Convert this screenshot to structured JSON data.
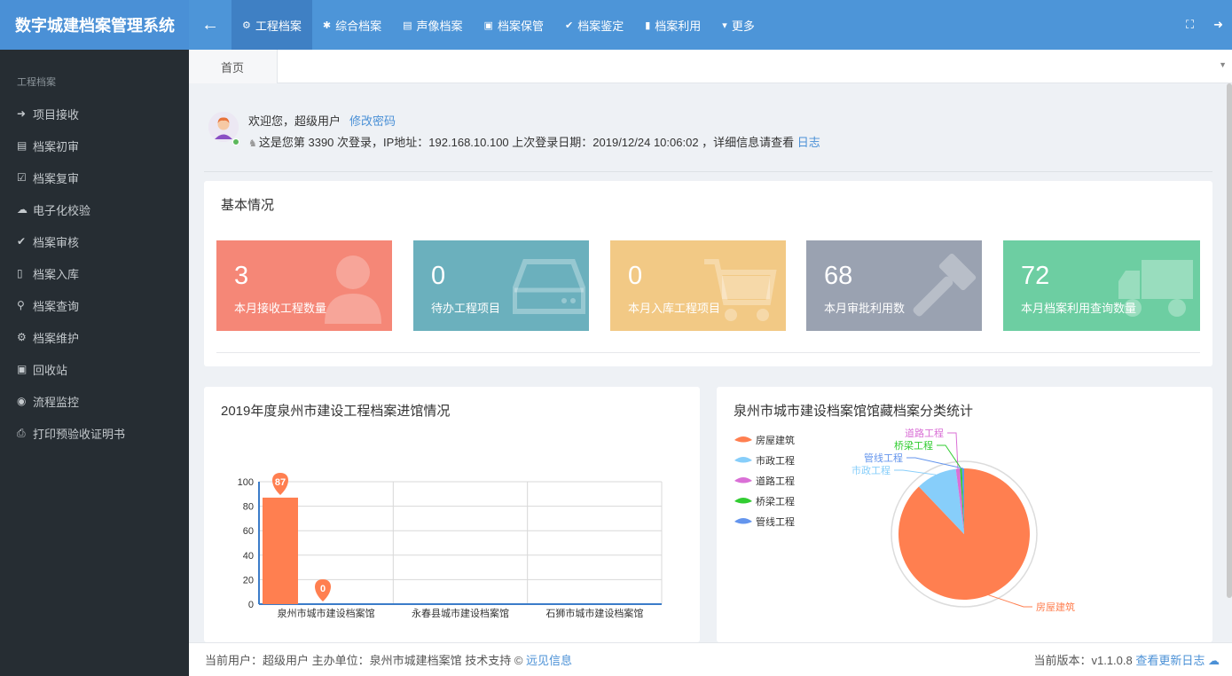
{
  "app": {
    "title": "数字城建档案管理系统",
    "back_icon": "arrow-left-icon"
  },
  "topnav": [
    {
      "label": "工程档案",
      "icon": "gear-icon",
      "active": true
    },
    {
      "label": "综合档案",
      "icon": "asterisk-icon",
      "active": false
    },
    {
      "label": "声像档案",
      "icon": "film-icon",
      "active": false
    },
    {
      "label": "档案保管",
      "icon": "archive-icon",
      "active": false
    },
    {
      "label": "档案鉴定",
      "icon": "check-circle-icon",
      "active": false
    },
    {
      "label": "档案利用",
      "icon": "bookmark-icon",
      "active": false
    },
    {
      "label": "更多",
      "icon": "caret-down-icon",
      "active": false
    }
  ],
  "sidebar": {
    "section": "工程档案",
    "items": [
      {
        "label": "项目接收",
        "icon": "arrow-right-icon"
      },
      {
        "label": "档案初审",
        "icon": "calendar-plus-icon"
      },
      {
        "label": "档案复审",
        "icon": "calendar-check-icon"
      },
      {
        "label": "电子化校验",
        "icon": "cloud-icon"
      },
      {
        "label": "档案审核",
        "icon": "check-icon"
      },
      {
        "label": "档案入库",
        "icon": "book-icon"
      },
      {
        "label": "档案查询",
        "icon": "search-icon"
      },
      {
        "label": "档案维护",
        "icon": "gear-icon"
      },
      {
        "label": "回收站",
        "icon": "trash-icon"
      },
      {
        "label": "流程监控",
        "icon": "dot-circle-icon"
      },
      {
        "label": "打印预验收证明书",
        "icon": "print-icon"
      }
    ]
  },
  "tabs": {
    "home": "首页"
  },
  "welcome": {
    "greeting": "欢迎您，超级用户",
    "change_password": "修改密码",
    "login_info": "这是您第 3390 次登录，IP地址：192.168.10.100 上次登录日期：2019/12/24 10:06:02 ，详细信息请查看",
    "log_link": "日志"
  },
  "basic": {
    "title": "基本情况",
    "stats": [
      {
        "value": "3",
        "label": "本月接收工程数量",
        "color": "#f58777",
        "icon": "user-icon"
      },
      {
        "value": "0",
        "label": "待办工程项目",
        "color": "#6bb0bd",
        "icon": "hdd-icon"
      },
      {
        "value": "0",
        "label": "本月入库工程项目",
        "color": "#f2c985",
        "icon": "cart-icon"
      },
      {
        "value": "68",
        "label": "本月审批利用数",
        "color": "#9aa2b1",
        "icon": "gavel-icon"
      },
      {
        "value": "72",
        "label": "本月档案利用查询数量",
        "color": "#6dcea2",
        "icon": "truck-icon"
      }
    ]
  },
  "chart_data": [
    {
      "type": "bar",
      "title": "2019年度泉州市建设工程档案进馆情况",
      "categories": [
        "泉州市城市建设档案馆",
        "永春县城市建设档案馆",
        "石狮市城市建设档案馆"
      ],
      "series": [
        {
          "values": [
            87,
            null,
            null
          ],
          "color": "#ff7f50"
        },
        {
          "values": [
            0,
            null,
            null
          ],
          "color": "#ff7f50"
        }
      ],
      "ylim": [
        0,
        100
      ],
      "yticks": [
        "0",
        "20",
        "40",
        "60",
        "80",
        "100"
      ],
      "data_labels": [
        "87",
        "0"
      ],
      "grid": true
    },
    {
      "type": "pie",
      "title": "泉州市城市建设档案馆馆藏档案分类统计",
      "slices": [
        {
          "name": "房屋建筑",
          "value": 87,
          "color": "#ff7f50"
        },
        {
          "name": "市政工程",
          "value": 10,
          "color": "#87cefa"
        },
        {
          "name": "道路工程",
          "value": 1,
          "color": "#da70d6"
        },
        {
          "name": "桥梁工程",
          "value": 0.5,
          "color": "#32cd32"
        },
        {
          "name": "管线工程",
          "value": 0.5,
          "color": "#6495ed"
        }
      ],
      "legend_position": "top-left"
    }
  ],
  "footer": {
    "left_text": "当前用户：超级用户 主办单位：泉州市城建档案馆 技术支持 ©",
    "left_link": "远见信息",
    "right_text": "当前版本：v1.1.0.8",
    "right_link": "查看更新日志"
  }
}
